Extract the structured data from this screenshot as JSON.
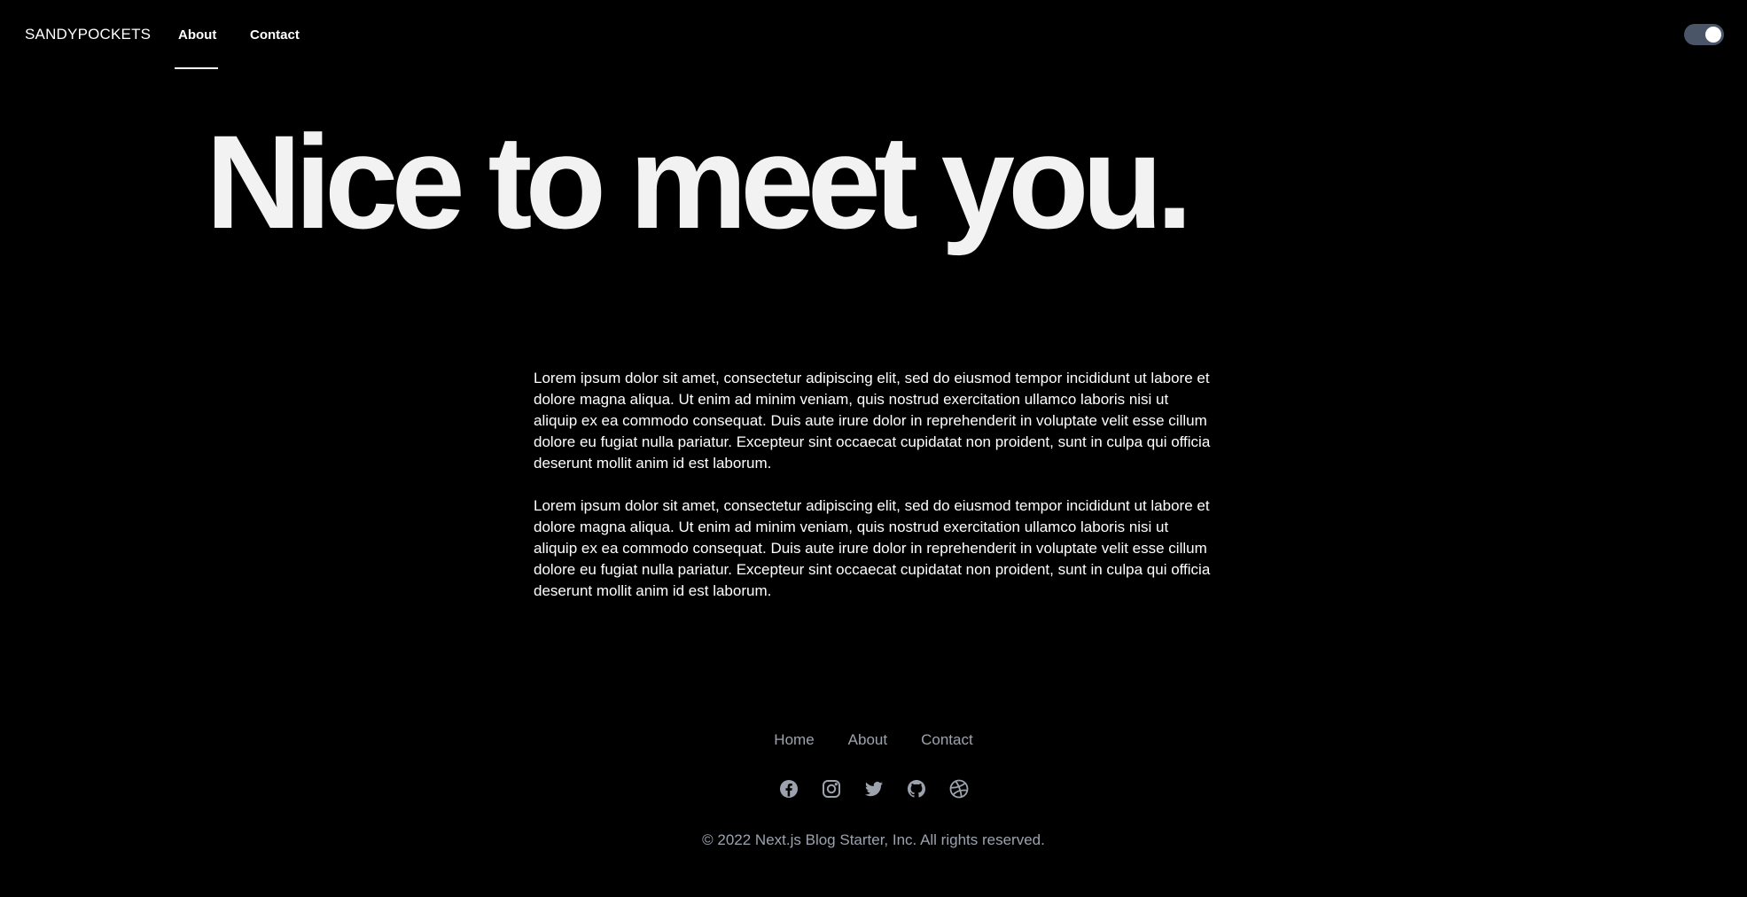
{
  "header": {
    "brand": "SANDYPOCKETS",
    "nav": [
      {
        "label": "About",
        "active": true
      },
      {
        "label": "Contact",
        "active": false
      }
    ],
    "theme_toggle": {
      "state": "on"
    }
  },
  "hero": {
    "title": "Nice to meet you."
  },
  "content": {
    "paragraphs": [
      "Lorem ipsum dolor sit amet, consectetur adipiscing elit, sed do eiusmod tempor incididunt ut labore et dolore magna aliqua. Ut enim ad minim veniam, quis nostrud exercitation ullamco laboris nisi ut aliquip ex ea commodo consequat. Duis aute irure dolor in reprehenderit in voluptate velit esse cillum dolore eu fugiat nulla pariatur. Excepteur sint occaecat cupidatat non proident, sunt in culpa qui officia deserunt mollit anim id est laborum.",
      "Lorem ipsum dolor sit amet, consectetur adipiscing elit, sed do eiusmod tempor incididunt ut labore et dolore magna aliqua. Ut enim ad minim veniam, quis nostrud exercitation ullamco laboris nisi ut aliquip ex ea commodo consequat. Duis aute irure dolor in reprehenderit in voluptate velit esse cillum dolore eu fugiat nulla pariatur. Excepteur sint occaecat cupidatat non proident, sunt in culpa qui officia deserunt mollit anim id est laborum."
    ]
  },
  "footer": {
    "links": [
      "Home",
      "About",
      "Contact"
    ],
    "social_icons": [
      "facebook-icon",
      "instagram-icon",
      "twitter-icon",
      "github-icon",
      "dribbble-icon"
    ],
    "copyright": "© 2022 Next.js Blog Starter, Inc. All rights reserved."
  },
  "colors": {
    "background": "#000000",
    "text": "#ffffff",
    "muted": "#9ca3af",
    "toggle_track": "#4a5568"
  }
}
